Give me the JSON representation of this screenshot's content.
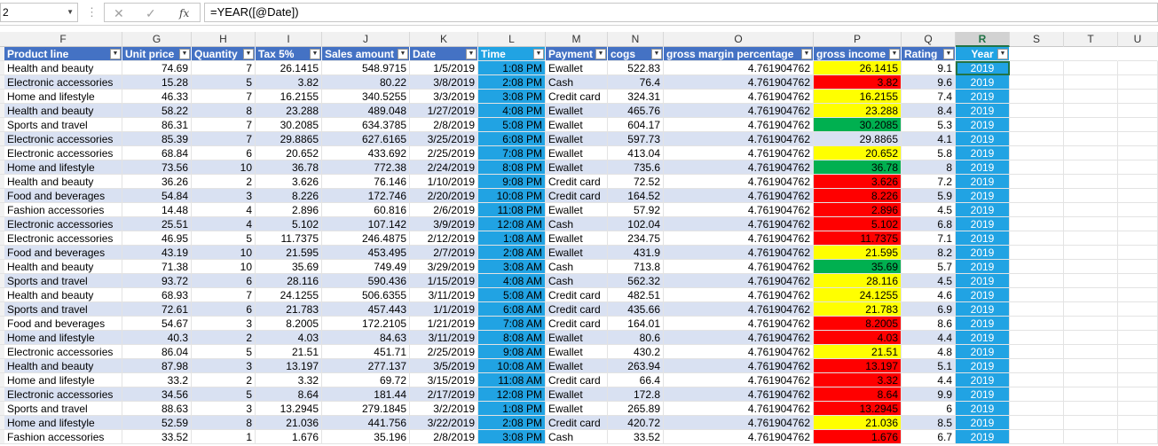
{
  "formula_bar": {
    "name_box": "2",
    "cancel_icon": "✕",
    "enter_icon": "✓",
    "fx_label": "fx",
    "formula": "=YEAR([@Date])"
  },
  "column_letters": [
    "F",
    "G",
    "H",
    "I",
    "J",
    "K",
    "L",
    "M",
    "N",
    "O",
    "P",
    "Q",
    "R",
    "S",
    "T",
    "U"
  ],
  "selected_column": "R",
  "headers": [
    "Product line",
    "Unit price",
    "Quantity",
    "Tax 5%",
    "Sales amount",
    "Date",
    "Time",
    "Payment",
    "cogs",
    "gross margin percentage",
    "gross income",
    "Rating",
    "Year"
  ],
  "rows": [
    [
      "Health and beauty",
      "74.69",
      "7",
      "26.1415",
      "548.9715",
      "1/5/2019",
      "1:08 PM",
      "Ewallet",
      "522.83",
      "4.761904762",
      "26.1415",
      "9.1",
      "2019"
    ],
    [
      "Electronic accessories",
      "15.28",
      "5",
      "3.82",
      "80.22",
      "3/8/2019",
      "2:08 PM",
      "Cash",
      "76.4",
      "4.761904762",
      "3.82",
      "9.6",
      "2019"
    ],
    [
      "Home and lifestyle",
      "46.33",
      "7",
      "16.2155",
      "340.5255",
      "3/3/2019",
      "3:08 PM",
      "Credit card",
      "324.31",
      "4.761904762",
      "16.2155",
      "7.4",
      "2019"
    ],
    [
      "Health and beauty",
      "58.22",
      "8",
      "23.288",
      "489.048",
      "1/27/2019",
      "4:08 PM",
      "Ewallet",
      "465.76",
      "4.761904762",
      "23.288",
      "8.4",
      "2019"
    ],
    [
      "Sports and travel",
      "86.31",
      "7",
      "30.2085",
      "634.3785",
      "2/8/2019",
      "5:08 PM",
      "Ewallet",
      "604.17",
      "4.761904762",
      "30.2085",
      "5.3",
      "2019"
    ],
    [
      "Electronic accessories",
      "85.39",
      "7",
      "29.8865",
      "627.6165",
      "3/25/2019",
      "6:08 PM",
      "Ewallet",
      "597.73",
      "4.761904762",
      "29.8865",
      "4.1",
      "2019"
    ],
    [
      "Electronic accessories",
      "68.84",
      "6",
      "20.652",
      "433.692",
      "2/25/2019",
      "7:08 PM",
      "Ewallet",
      "413.04",
      "4.761904762",
      "20.652",
      "5.8",
      "2019"
    ],
    [
      "Home and lifestyle",
      "73.56",
      "10",
      "36.78",
      "772.38",
      "2/24/2019",
      "8:08 PM",
      "Ewallet",
      "735.6",
      "4.761904762",
      "36.78",
      "8",
      "2019"
    ],
    [
      "Health and beauty",
      "36.26",
      "2",
      "3.626",
      "76.146",
      "1/10/2019",
      "9:08 PM",
      "Credit card",
      "72.52",
      "4.761904762",
      "3.626",
      "7.2",
      "2019"
    ],
    [
      "Food and beverages",
      "54.84",
      "3",
      "8.226",
      "172.746",
      "2/20/2019",
      "10:08 PM",
      "Credit card",
      "164.52",
      "4.761904762",
      "8.226",
      "5.9",
      "2019"
    ],
    [
      "Fashion accessories",
      "14.48",
      "4",
      "2.896",
      "60.816",
      "2/6/2019",
      "11:08 PM",
      "Ewallet",
      "57.92",
      "4.761904762",
      "2.896",
      "4.5",
      "2019"
    ],
    [
      "Electronic accessories",
      "25.51",
      "4",
      "5.102",
      "107.142",
      "3/9/2019",
      "12:08 AM",
      "Cash",
      "102.04",
      "4.761904762",
      "5.102",
      "6.8",
      "2019"
    ],
    [
      "Electronic accessories",
      "46.95",
      "5",
      "11.7375",
      "246.4875",
      "2/12/2019",
      "1:08 AM",
      "Ewallet",
      "234.75",
      "4.761904762",
      "11.7375",
      "7.1",
      "2019"
    ],
    [
      "Food and beverages",
      "43.19",
      "10",
      "21.595",
      "453.495",
      "2/7/2019",
      "2:08 AM",
      "Ewallet",
      "431.9",
      "4.761904762",
      "21.595",
      "8.2",
      "2019"
    ],
    [
      "Health and beauty",
      "71.38",
      "10",
      "35.69",
      "749.49",
      "3/29/2019",
      "3:08 AM",
      "Cash",
      "713.8",
      "4.761904762",
      "35.69",
      "5.7",
      "2019"
    ],
    [
      "Sports and travel",
      "93.72",
      "6",
      "28.116",
      "590.436",
      "1/15/2019",
      "4:08 AM",
      "Cash",
      "562.32",
      "4.761904762",
      "28.116",
      "4.5",
      "2019"
    ],
    [
      "Health and beauty",
      "68.93",
      "7",
      "24.1255",
      "506.6355",
      "3/11/2019",
      "5:08 AM",
      "Credit card",
      "482.51",
      "4.761904762",
      "24.1255",
      "4.6",
      "2019"
    ],
    [
      "Sports and travel",
      "72.61",
      "6",
      "21.783",
      "457.443",
      "1/1/2019",
      "6:08 AM",
      "Credit card",
      "435.66",
      "4.761904762",
      "21.783",
      "6.9",
      "2019"
    ],
    [
      "Food and beverages",
      "54.67",
      "3",
      "8.2005",
      "172.2105",
      "1/21/2019",
      "7:08 AM",
      "Credit card",
      "164.01",
      "4.761904762",
      "8.2005",
      "8.6",
      "2019"
    ],
    [
      "Home and lifestyle",
      "40.3",
      "2",
      "4.03",
      "84.63",
      "3/11/2019",
      "8:08 AM",
      "Ewallet",
      "80.6",
      "4.761904762",
      "4.03",
      "4.4",
      "2019"
    ],
    [
      "Electronic accessories",
      "86.04",
      "5",
      "21.51",
      "451.71",
      "2/25/2019",
      "9:08 AM",
      "Ewallet",
      "430.2",
      "4.761904762",
      "21.51",
      "4.8",
      "2019"
    ],
    [
      "Health and beauty",
      "87.98",
      "3",
      "13.197",
      "277.137",
      "3/5/2019",
      "10:08 AM",
      "Ewallet",
      "263.94",
      "4.761904762",
      "13.197",
      "5.1",
      "2019"
    ],
    [
      "Home and lifestyle",
      "33.2",
      "2",
      "3.32",
      "69.72",
      "3/15/2019",
      "11:08 AM",
      "Credit card",
      "66.4",
      "4.761904762",
      "3.32",
      "4.4",
      "2019"
    ],
    [
      "Electronic accessories",
      "34.56",
      "5",
      "8.64",
      "181.44",
      "2/17/2019",
      "12:08 PM",
      "Ewallet",
      "172.8",
      "4.761904762",
      "8.64",
      "9.9",
      "2019"
    ],
    [
      "Sports and travel",
      "88.63",
      "3",
      "13.2945",
      "279.1845",
      "3/2/2019",
      "1:08 PM",
      "Ewallet",
      "265.89",
      "4.761904762",
      "13.2945",
      "6",
      "2019"
    ],
    [
      "Home and lifestyle",
      "52.59",
      "8",
      "21.036",
      "441.756",
      "3/22/2019",
      "2:08 PM",
      "Credit card",
      "420.72",
      "4.761904762",
      "21.036",
      "8.5",
      "2019"
    ],
    [
      "Fashion accessories",
      "33.52",
      "1",
      "1.676",
      "35.196",
      "2/8/2019",
      "3:08 PM",
      "Cash",
      "33.52",
      "4.761904762",
      "1.676",
      "6.7",
      "2019"
    ]
  ],
  "gross_income_fill": [
    "yellow",
    "red",
    "yellow",
    "yellow",
    "green",
    "none",
    "yellow",
    "green",
    "red",
    "red",
    "red",
    "red",
    "red",
    "yellow",
    "green",
    "yellow",
    "yellow",
    "yellow",
    "red",
    "red",
    "yellow",
    "red",
    "red",
    "red",
    "red",
    "yellow",
    "red"
  ],
  "colors": {
    "header_fill": "#4472c4",
    "band_fill": "#d9e1f2",
    "time_fill": "#21a3e3",
    "year_fill": "#21a3e3",
    "fill_yellow": "#ffff00",
    "fill_red": "#ff0000",
    "fill_green": "#00b050",
    "selection": "#217346"
  }
}
